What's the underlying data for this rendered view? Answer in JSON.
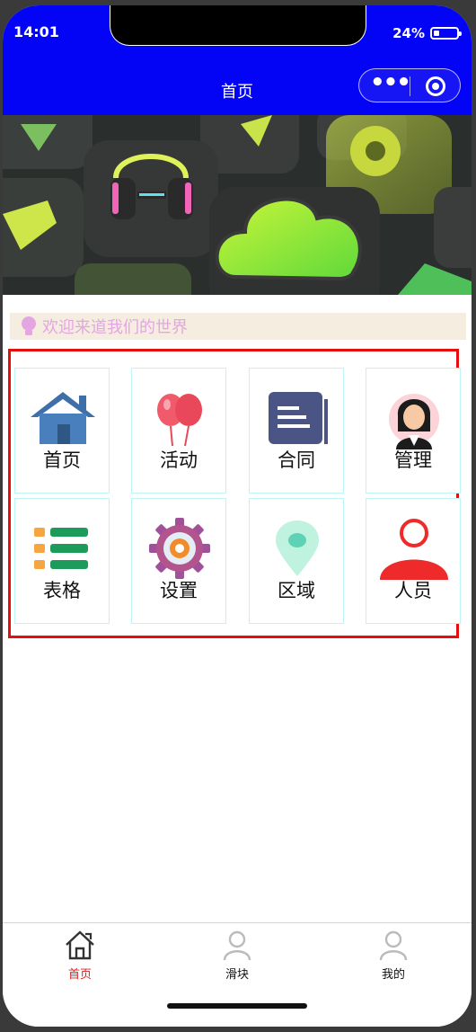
{
  "status_bar": {
    "time": "14:01",
    "battery": "24%"
  },
  "nav": {
    "title": "首页"
  },
  "banner": {
    "active_slide": 2,
    "slide_count": 2
  },
  "notice": {
    "text": "欢迎来道我们的世界"
  },
  "grid": {
    "items": [
      {
        "label": "首页",
        "icon": "house-icon"
      },
      {
        "label": "活动",
        "icon": "balloons-icon"
      },
      {
        "label": "合同",
        "icon": "document-icon"
      },
      {
        "label": "管理",
        "icon": "manager-avatar-icon"
      },
      {
        "label": "表格",
        "icon": "list-table-icon"
      },
      {
        "label": "设置",
        "icon": "gear-icon"
      },
      {
        "label": "区域",
        "icon": "location-pin-icon"
      },
      {
        "label": "人员",
        "icon": "person-icon"
      }
    ]
  },
  "tabbar": {
    "items": [
      {
        "label": "首页",
        "icon": "home-icon",
        "active": true
      },
      {
        "label": "滑块",
        "icon": "user-icon",
        "active": false
      },
      {
        "label": "我的",
        "icon": "user-icon",
        "active": false
      }
    ]
  },
  "colors": {
    "nav_bg": "#0303f5",
    "highlight_border": "#e60d0d",
    "active_tab": "#d62020",
    "notice_text": "#e3a6e0"
  }
}
